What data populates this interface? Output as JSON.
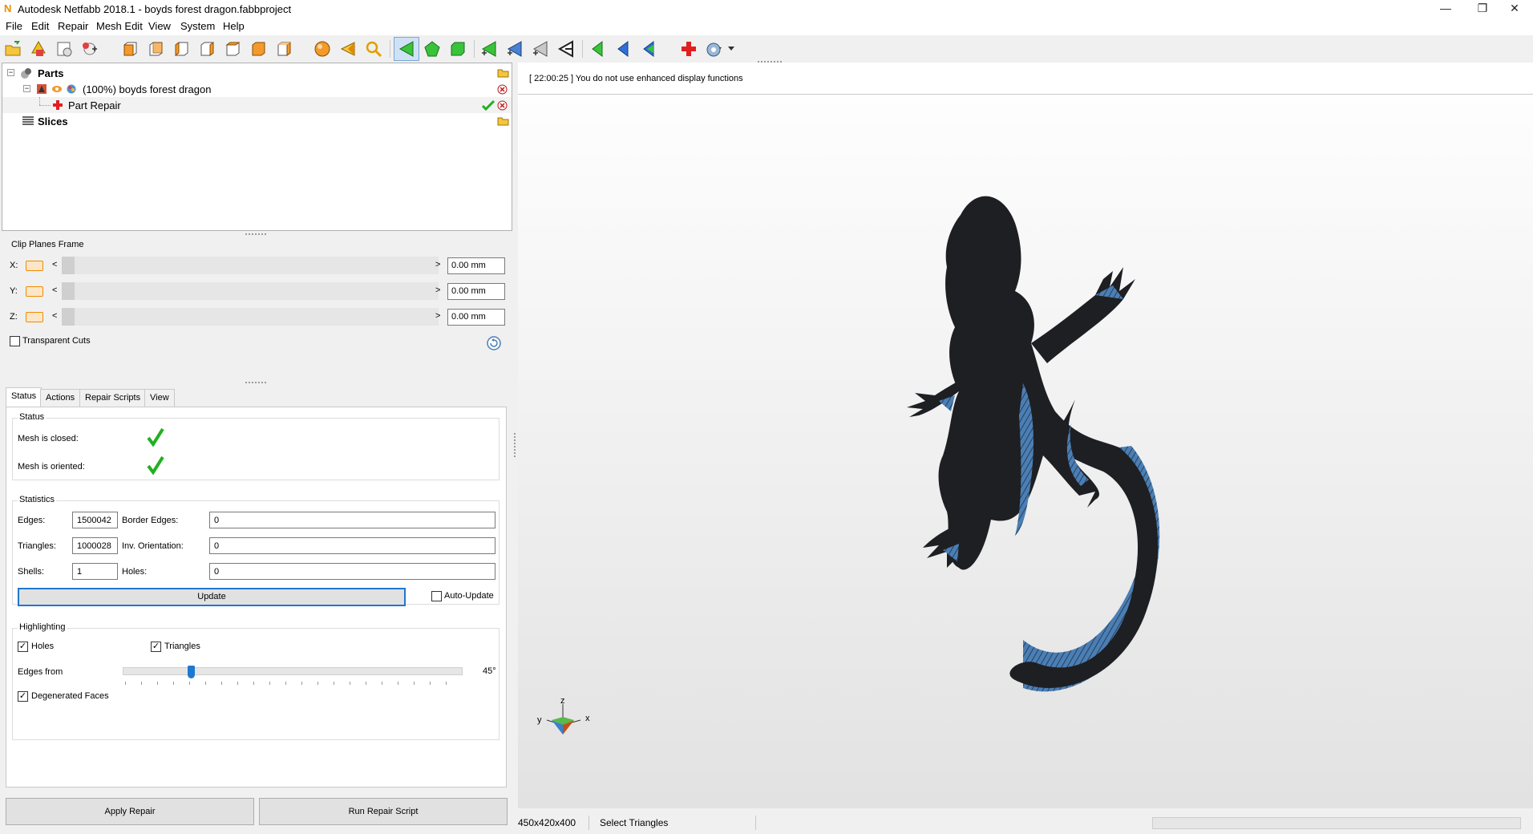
{
  "window": {
    "title": "Autodesk Netfabb 2018.1 - boyds forest dragon.fabbproject",
    "controls": {
      "minimize": "—",
      "restore": "❐",
      "close": "✕"
    }
  },
  "menu": [
    "File",
    "Edit",
    "Repair",
    "Mesh Edit",
    "View",
    "System",
    "Help"
  ],
  "toolbar": {
    "icons": [
      "open-project-icon",
      "add-part-icon",
      "load-icon",
      "add-icon",
      "view-front-icon",
      "view-back-icon",
      "view-left-icon",
      "view-right-icon",
      "view-top-icon",
      "view-bottom-icon",
      "view-iso-icon",
      "shaded-sphere-icon",
      "select-arrow-icon",
      "zoom-icon",
      "select-triangle-icon",
      "select-surface-icon",
      "select-shell-icon",
      "add-triangle-icon",
      "add-triangle-alt-icon",
      "tri-gray-icon",
      "tri-brush-icon",
      "green-arrow-left-icon",
      "blue-arrow-left-icon",
      "green-blue-arrow-icon",
      "repair-cross-icon",
      "repair-tools-icon"
    ]
  },
  "tree": {
    "parts_label": "Parts",
    "part_name": "(100%) boyds forest dragon",
    "part_repair": "Part Repair",
    "slices_label": "Slices"
  },
  "clip": {
    "title": "Clip Planes Frame",
    "rows": [
      {
        "axis": "X:",
        "lt": "<",
        "gt": ">",
        "value": "0.00 mm"
      },
      {
        "axis": "Y:",
        "lt": "<",
        "gt": ">",
        "value": "0.00 mm"
      },
      {
        "axis": "Z:",
        "lt": "<",
        "gt": ">",
        "value": "0.00 mm"
      }
    ],
    "transparent_cuts": "Transparent Cuts",
    "transparent_checked": false
  },
  "tabs": [
    "Status",
    "Actions",
    "Repair Scripts",
    "View"
  ],
  "status": {
    "title": "Status",
    "mesh_closed": "Mesh is closed:",
    "mesh_oriented": "Mesh is oriented:"
  },
  "statistics": {
    "title": "Statistics",
    "edges_label": "Edges:",
    "edges": "1500042",
    "border_edges_label": "Border Edges:",
    "border_edges": "0",
    "triangles_label": "Triangles:",
    "triangles": "1000028",
    "inv_orientation_label": "Inv. Orientation:",
    "inv_orientation": "0",
    "shells_label": "Shells:",
    "shells": "1",
    "holes_label": "Holes:",
    "holes": "0",
    "update_button": "Update",
    "auto_update": "Auto-Update"
  },
  "highlighting": {
    "title": "Highlighting",
    "holes": "Holes",
    "holes_checked": "✓",
    "triangles": "Triangles",
    "triangles_checked": "✓",
    "edges_from": "Edges from",
    "edges_angle": "45°",
    "edges_slider_fraction": 0.2,
    "degenerated": "Degenerated Faces",
    "degenerated_checked": "✓"
  },
  "buttons": {
    "apply_repair": "Apply Repair",
    "run_repair_script": "Run Repair Script"
  },
  "viewport": {
    "log": "[ 22:00:25 ] You do not use enhanced display functions",
    "axes": {
      "z": "z",
      "y": "y",
      "x": "x"
    }
  },
  "statusbar": {
    "dimensions": "450x420x400",
    "mode": "Select Triangles"
  },
  "colors": {
    "accent_blue": "#4a7fb5",
    "model_dark": "#1e1f22",
    "check_green": "#22b022",
    "orange": "#f08a00"
  }
}
